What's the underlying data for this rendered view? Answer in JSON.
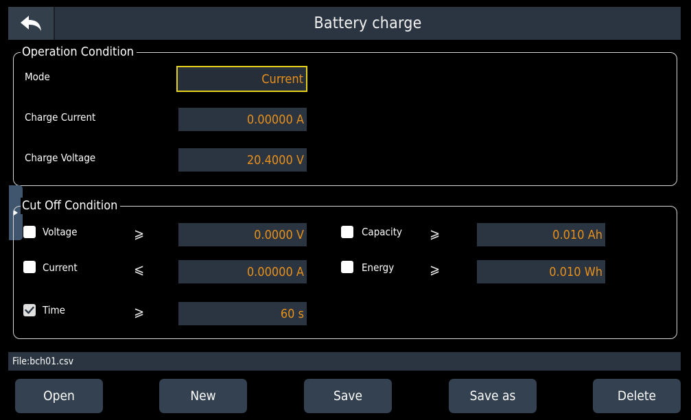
{
  "header": {
    "title": "Battery charge",
    "back_icon": "back-arrow-icon"
  },
  "operation": {
    "legend": "Operation Condition",
    "mode_label": "Mode",
    "mode_value": "Current",
    "charge_current_label": "Charge Current",
    "charge_current_value": "0.00000 A",
    "charge_voltage_label": "Charge Voltage",
    "charge_voltage_value": "20.4000 V"
  },
  "cutoff": {
    "legend": "Cut Off Condition",
    "voltage": {
      "label": "Voltage",
      "checked": false,
      "comparator": "⩾",
      "value": "0.0000 V"
    },
    "current": {
      "label": "Current",
      "checked": false,
      "comparator": "⩽",
      "value": "0.00000 A"
    },
    "time": {
      "label": "Time",
      "checked": true,
      "comparator": "⩾",
      "value": "60 s"
    },
    "capacity": {
      "label": "Capacity",
      "checked": false,
      "comparator": "⩾",
      "value": "0.010 Ah"
    },
    "energy": {
      "label": "Energy",
      "checked": false,
      "comparator": "⩾",
      "value": "0.010 Wh"
    }
  },
  "file": {
    "text": "File:bch01.csv"
  },
  "buttons": {
    "open": "Open",
    "new": "New",
    "save": "Save",
    "save_as": "Save as",
    "delete": "Delete"
  },
  "colors": {
    "value_text": "#e8901a",
    "field_bg": "#2b3541",
    "selected_border": "#e6d21a",
    "button_bg": "#334150"
  }
}
